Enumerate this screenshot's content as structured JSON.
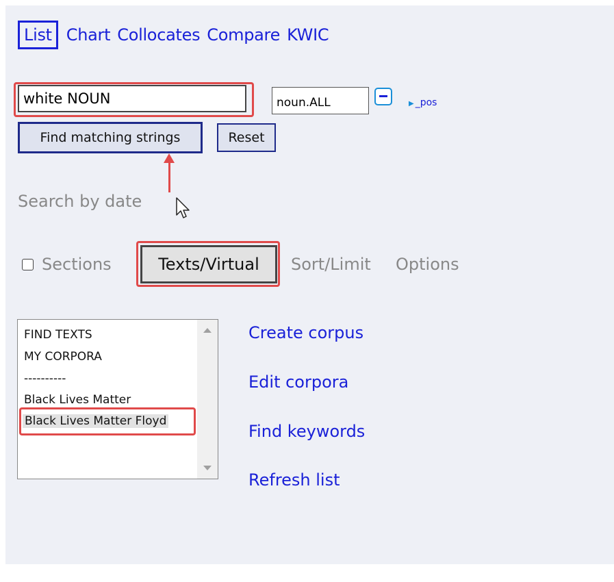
{
  "nav": {
    "tabs": [
      {
        "label": "List",
        "active": true
      },
      {
        "label": "Chart"
      },
      {
        "label": "Collocates"
      },
      {
        "label": "Compare"
      },
      {
        "label": "KWIC"
      }
    ]
  },
  "search": {
    "word_value": "white NOUN",
    "pos_value": "noun.ALL",
    "pos_toggle_label": "_pos"
  },
  "buttons": {
    "find_label": "Find matching strings",
    "reset_label": "Reset"
  },
  "search_by_date_label": "Search by date",
  "tabs": {
    "sections_label": "Sections",
    "sections_checked": false,
    "texts_virtual_label": "Texts/Virtual",
    "sort_limit_label": "Sort/Limit",
    "options_label": "Options"
  },
  "corpus_list": {
    "items": [
      "FIND TEXTS",
      "MY CORPORA",
      "----------",
      "Black Lives Matter",
      "Black Lives Matter Floyd"
    ],
    "selected": "Black Lives Matter Floyd"
  },
  "links": {
    "create_corpus": "Create corpus",
    "edit_corpora": "Edit corpora",
    "find_keywords": "Find keywords",
    "refresh_list": "Refresh list"
  },
  "colors": {
    "link_blue": "#1a21d8",
    "highlight_red": "#e04a4a",
    "panel_bg": "#eef0f6"
  }
}
